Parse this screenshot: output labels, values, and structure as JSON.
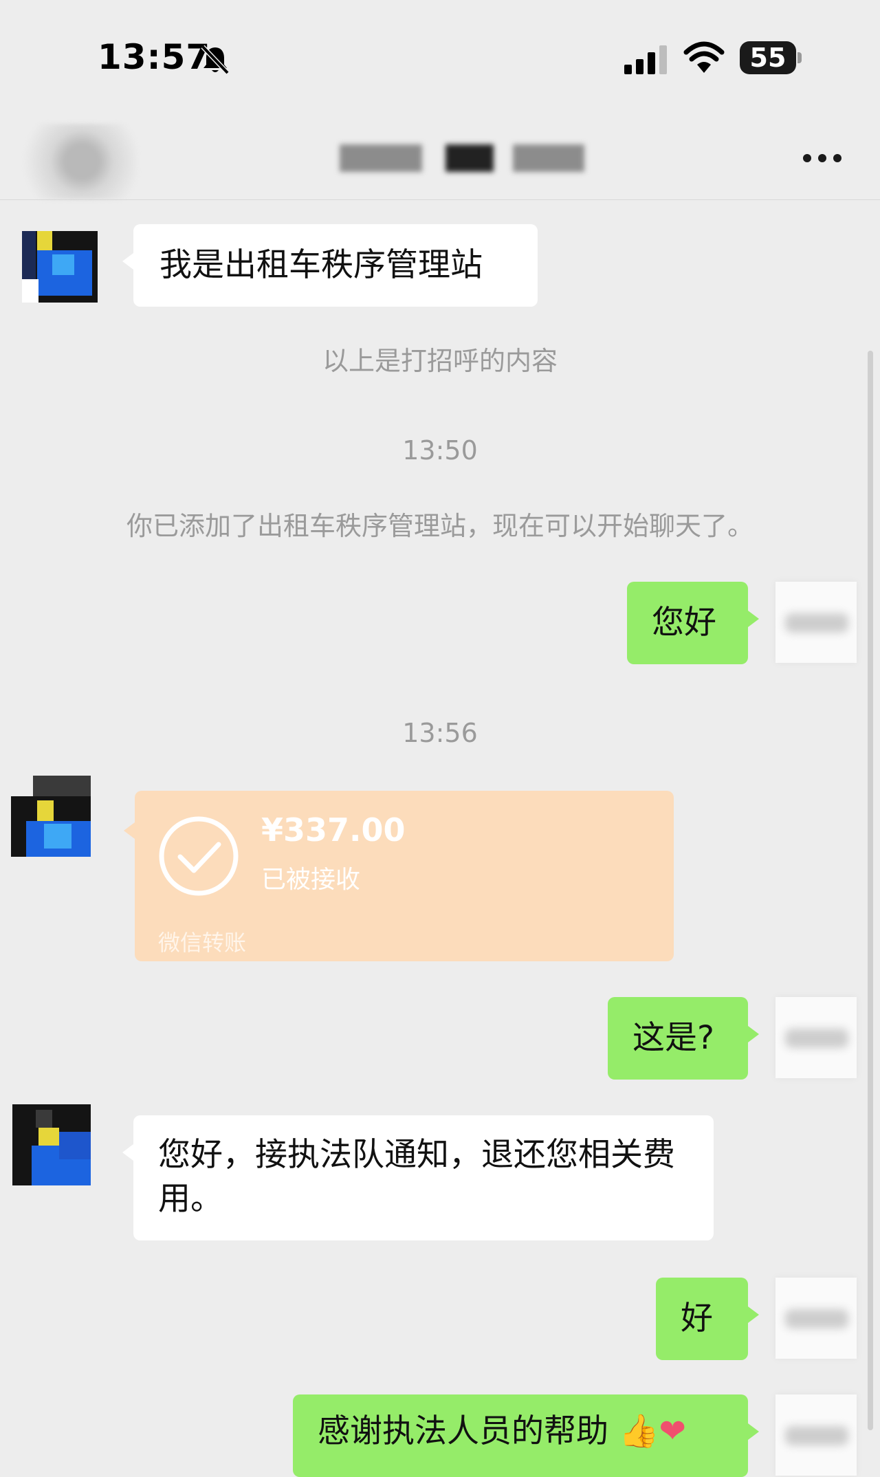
{
  "status_bar": {
    "time": "13:57",
    "battery": "55"
  },
  "chat": {
    "messages": [
      {
        "side": "left",
        "text": "我是出租车秩序管理站"
      },
      {
        "side": "system",
        "text": "以上是打招呼的内容"
      },
      {
        "side": "time",
        "text": "13:50"
      },
      {
        "side": "system",
        "text": "你已添加了出租车秩序管理站，现在可以开始聊天了。"
      },
      {
        "side": "right",
        "text": "您好"
      },
      {
        "side": "time",
        "text": "13:56"
      },
      {
        "side": "left",
        "type": "transfer",
        "amount": "¥337.00",
        "status": "已被接收",
        "label": "微信转账"
      },
      {
        "side": "right",
        "text": "这是?"
      },
      {
        "side": "left",
        "text": "您好，接执法队通知，退还您相关费用。"
      },
      {
        "side": "right",
        "text": "好"
      },
      {
        "side": "right",
        "text": "感谢执法人员的帮助"
      }
    ]
  },
  "icons": [
    "bell-off-icon",
    "signal-icon",
    "wifi-icon",
    "battery-icon",
    "more-icon",
    "check-icon",
    "thumbs-up-icon",
    "heart-icon"
  ],
  "colors": {
    "background": "#ededed",
    "bubble_self": "#95ec69",
    "bubble_other": "#ffffff",
    "transfer": "#fcdcbb"
  }
}
